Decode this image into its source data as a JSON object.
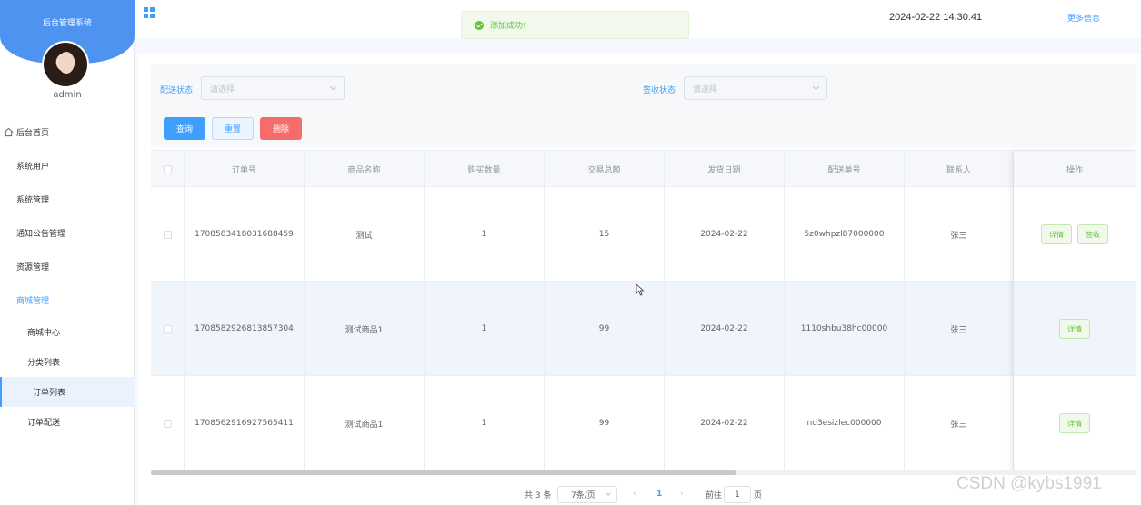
{
  "sidebar": {
    "title": "后台管理系统",
    "username": "admin",
    "menu": [
      {
        "label": "后台首页"
      },
      {
        "label": "系统用户"
      },
      {
        "label": "系统管理"
      },
      {
        "label": "通知公告管理"
      },
      {
        "label": "资源管理"
      },
      {
        "label": "商城管理"
      }
    ],
    "submenu": [
      {
        "label": "商城中心"
      },
      {
        "label": "分类列表"
      },
      {
        "label": "订单列表"
      },
      {
        "label": "订单配送"
      }
    ]
  },
  "topbar": {
    "datetime": "2024-02-22 14:30:41",
    "more_info": "更多信息"
  },
  "toast": {
    "message": "添加成功!"
  },
  "search": {
    "delivery_status_label": "配送状态",
    "delivery_status_placeholder": "请选择",
    "receipt_status_label": "签收状态",
    "receipt_status_placeholder": "请选择",
    "query_button": "查询",
    "reset_button": "重置",
    "delete_button": "删除"
  },
  "table": {
    "headers": [
      "订单号",
      "商品名称",
      "购买数量",
      "交易总额",
      "发货日期",
      "配送单号",
      "联系人",
      "操作"
    ],
    "rows": [
      {
        "order_no": "1708583418031688459",
        "product": "测试",
        "qty": "1",
        "total": "15",
        "ship_date": "2024-02-22",
        "tracking": "5z0whpzl87000000",
        "contact": "张三",
        "actions": [
          "详情",
          "签收"
        ]
      },
      {
        "order_no": "1708582926813857304",
        "product": "测试商品1",
        "qty": "1",
        "total": "99",
        "ship_date": "2024-02-22",
        "tracking": "1110shbu38hc00000",
        "contact": "张三",
        "actions": [
          "详情"
        ]
      },
      {
        "order_no": "1708562916927565411",
        "product": "测试商品1",
        "qty": "1",
        "total": "99",
        "ship_date": "2024-02-22",
        "tracking": "nd3esizlec000000",
        "contact": "张三",
        "actions": [
          "详情"
        ]
      }
    ]
  },
  "pagination": {
    "total_text": "共 3 条",
    "page_size": "7条/页",
    "prev": "‹",
    "current_page": "1",
    "next": "›",
    "goto_label": "前往",
    "goto_value": "1",
    "page_suffix": "页"
  },
  "watermark": "CSDN @kybs1991",
  "colors": {
    "primary": "#409eff",
    "success": "#67c23a",
    "danger": "#f56c6c",
    "sidebar_header": "#4e93f0"
  }
}
